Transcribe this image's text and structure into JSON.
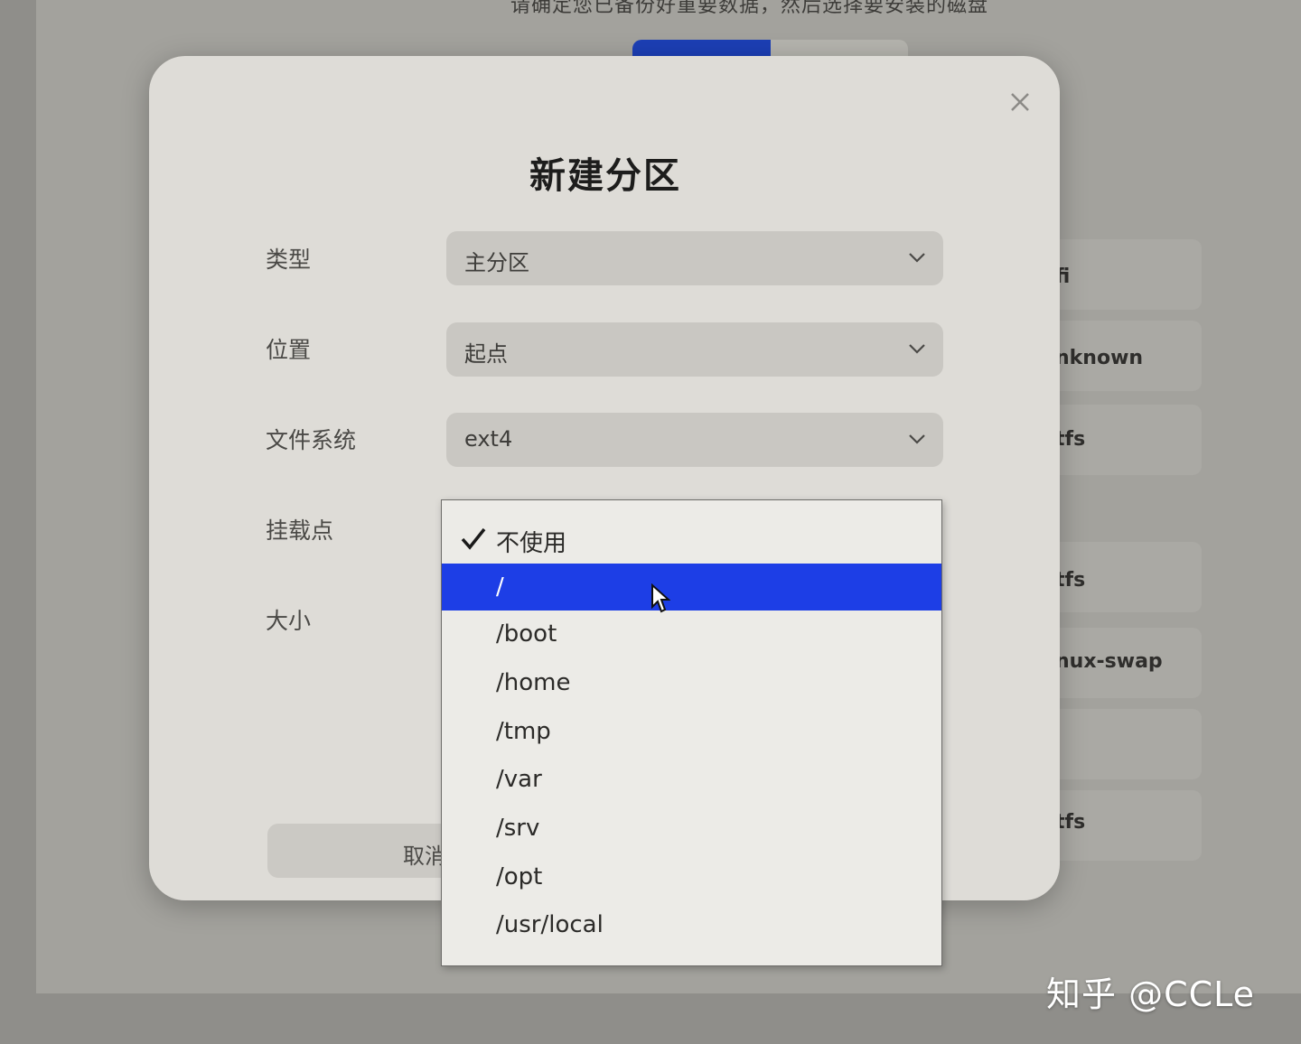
{
  "background": {
    "top_text": "请确定您已备份好重要数据，然后选择要安装的磁盘",
    "progress": 0.5,
    "list_labels": [
      "fi",
      "nknown",
      "tfs",
      "tfs",
      "nux-swap",
      "tfs"
    ]
  },
  "dialog": {
    "title": "新建分区",
    "close_icon": "close-icon",
    "fields": {
      "type": {
        "label": "类型",
        "value": "主分区"
      },
      "position": {
        "label": "位置",
        "value": "起点"
      },
      "filesystem": {
        "label": "文件系统",
        "value": "ext4"
      },
      "mount": {
        "label": "挂载点"
      },
      "size": {
        "label": "大小"
      }
    },
    "cancel_label": "取消"
  },
  "dropdown": {
    "options": [
      "不使用",
      "/",
      "/boot",
      "/home",
      "/tmp",
      "/var",
      "/srv",
      "/opt",
      "/usr/local"
    ],
    "checked_index": 0,
    "highlighted_index": 1
  },
  "colors": {
    "highlight": "#1d3ee6",
    "dialog_bg": "#dedcd7"
  },
  "watermark": "知乎 @CCLe"
}
